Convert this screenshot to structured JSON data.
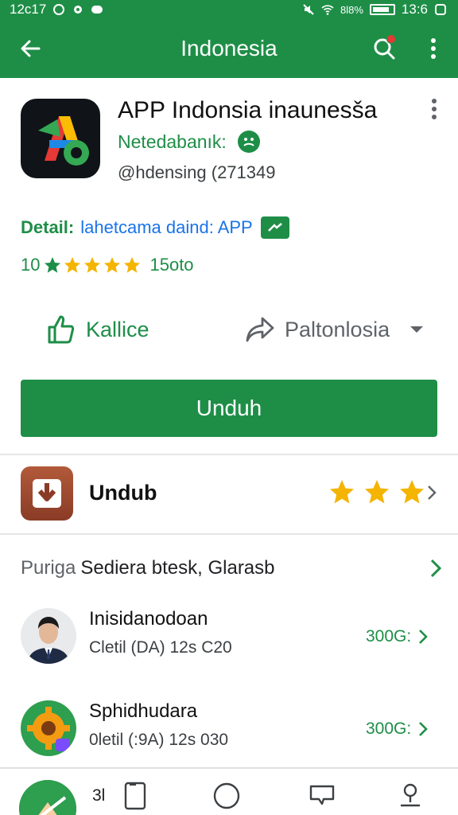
{
  "status_bar": {
    "time": "12c17",
    "battery_text": "8l8%",
    "clock_right": "13:6"
  },
  "appbar": {
    "title": "Indonesia"
  },
  "app": {
    "name": "APP Indonsia inaunesša",
    "developer": "Netedabanık:",
    "handle": "@hdensing (271349",
    "detail_label": "Detail:",
    "detail_sep": ":",
    "detail_link": "lahetcama daind: APP",
    "rating_value": "10",
    "rating_count": "15oto",
    "rating_stars": 4,
    "like_label": "Kallice",
    "share_label": "Paltonlosia",
    "install_label": "Unduh"
  },
  "download_row": {
    "title": "Undub",
    "stars": 3
  },
  "section": {
    "prefix": "Puriga",
    "title": "Sediera btesk, Glarasb"
  },
  "list": [
    {
      "title": "Inisidanodoan",
      "subtitle": "Cletil (DA) 12s C20",
      "count": "300G:"
    },
    {
      "title": "Sphidhudara",
      "subtitle": "0letil (:9A) 12s 030",
      "count": "300G:"
    }
  ],
  "bottom_nav": {
    "count": "3l"
  },
  "colors": {
    "primary": "#1e8e47",
    "star": "#f4b400",
    "link": "#1a73e8"
  }
}
